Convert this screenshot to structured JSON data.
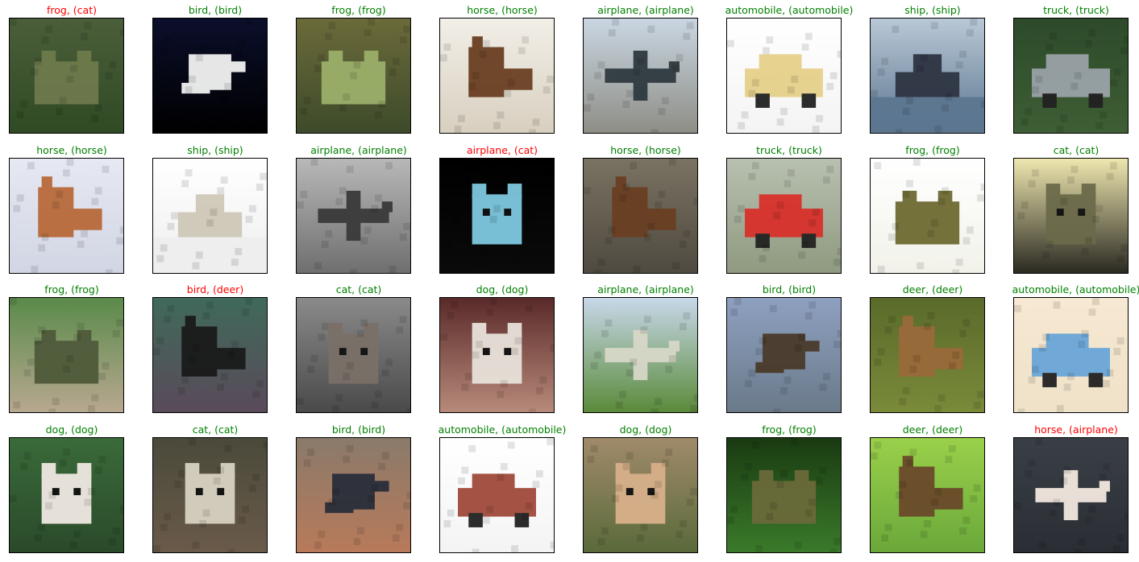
{
  "figure": {
    "panels": [
      {
        "label": "frog, (cat)",
        "correct": false,
        "subject": "frog-photo",
        "bg": [
          "#4b5e3a",
          "#2f4a24"
        ],
        "fg": "#6e7a4c"
      },
      {
        "label": "bird, (bird)",
        "correct": true,
        "subject": "bird-photo",
        "bg": [
          "#0b0f2a",
          "#000000"
        ],
        "fg": "#f2f2f2"
      },
      {
        "label": "frog, (frog)",
        "correct": true,
        "subject": "frog-photo",
        "bg": [
          "#6b6a3a",
          "#3d4a2a"
        ],
        "fg": "#9bb06a"
      },
      {
        "label": "horse, (horse)",
        "correct": true,
        "subject": "horse-photo",
        "bg": [
          "#f2efe8",
          "#d8cfbf"
        ],
        "fg": "#6a3f22"
      },
      {
        "label": "airplane, (airplane)",
        "correct": true,
        "subject": "airplane-photo",
        "bg": [
          "#c9d6e2",
          "#8e8e86"
        ],
        "fg": "#2f3a40"
      },
      {
        "label": "automobile, (automobile)",
        "correct": true,
        "subject": "automobile-photo",
        "bg": [
          "#ffffff",
          "#f4f4f4"
        ],
        "fg": "#e6d08a"
      },
      {
        "label": "ship, (ship)",
        "correct": true,
        "subject": "ship-photo",
        "bg": [
          "#b9c8d6",
          "#5c7690"
        ],
        "fg": "#2e3442"
      },
      {
        "label": "truck, (truck)",
        "correct": true,
        "subject": "truck-photo",
        "bg": [
          "#2d4a2a",
          "#3e5e35"
        ],
        "fg": "#9aa3a8"
      },
      {
        "label": "horse, (horse)",
        "correct": true,
        "subject": "horse-photo",
        "bg": [
          "#e6e8f2",
          "#d2d6e4"
        ],
        "fg": "#b86a3a"
      },
      {
        "label": "ship, (ship)",
        "correct": true,
        "subject": "ship-photo",
        "bg": [
          "#ffffff",
          "#eeeeee"
        ],
        "fg": "#cfc8b8"
      },
      {
        "label": "airplane, (airplane)",
        "correct": true,
        "subject": "airplane-photo",
        "bg": [
          "#b8b8b8",
          "#6f6f6f"
        ],
        "fg": "#3a3a3a"
      },
      {
        "label": "airplane, (cat)",
        "correct": false,
        "subject": "cat-photo",
        "bg": [
          "#000000",
          "#0a0a0a"
        ],
        "fg": "#7fc8e0"
      },
      {
        "label": "horse, (horse)",
        "correct": true,
        "subject": "horse-photo",
        "bg": [
          "#7a7262",
          "#4f4a40"
        ],
        "fg": "#6a3f22"
      },
      {
        "label": "truck, (truck)",
        "correct": true,
        "subject": "truck-photo",
        "bg": [
          "#b8c0b0",
          "#8f9a80"
        ],
        "fg": "#d8302a"
      },
      {
        "label": "frog, (frog)",
        "correct": true,
        "subject": "frog-photo",
        "bg": [
          "#ffffff",
          "#f2f2ea"
        ],
        "fg": "#6e6a32"
      },
      {
        "label": "cat, (cat)",
        "correct": true,
        "subject": "cat-photo",
        "bg": [
          "#efe7b0",
          "#2a2a22"
        ],
        "fg": "#6b6a4a"
      },
      {
        "label": "frog, (frog)",
        "correct": true,
        "subject": "frog-photo",
        "bg": [
          "#5a8a4a",
          "#b8a890"
        ],
        "fg": "#4f5a3a"
      },
      {
        "label": "bird, (deer)",
        "correct": false,
        "subject": "deer-photo",
        "bg": [
          "#3f6a5a",
          "#5a4a5a"
        ],
        "fg": "#1a1a1a"
      },
      {
        "label": "cat, (cat)",
        "correct": true,
        "subject": "cat-photo",
        "bg": [
          "#8a8a8a",
          "#4a4a4a"
        ],
        "fg": "#7a7068"
      },
      {
        "label": "dog, (dog)",
        "correct": true,
        "subject": "dog-photo",
        "bg": [
          "#5a2a2a",
          "#b88a7a"
        ],
        "fg": "#e8e2da"
      },
      {
        "label": "airplane, (airplane)",
        "correct": true,
        "subject": "airplane-photo",
        "bg": [
          "#c8d8ea",
          "#5a8a3a"
        ],
        "fg": "#d8d8c8"
      },
      {
        "label": "bird, (bird)",
        "correct": true,
        "subject": "bird-photo",
        "bg": [
          "#8ea0c0",
          "#6a7a8a"
        ],
        "fg": "#4a3a2a"
      },
      {
        "label": "deer, (deer)",
        "correct": true,
        "subject": "deer-photo",
        "bg": [
          "#5a6a2a",
          "#7a8a3a"
        ],
        "fg": "#9a6a3a"
      },
      {
        "label": "automobile, (automobile)",
        "correct": true,
        "subject": "automobile-photo",
        "bg": [
          "#f6e8d2",
          "#efe2c8"
        ],
        "fg": "#6aa6d8"
      },
      {
        "label": "dog, (dog)",
        "correct": true,
        "subject": "dog-photo",
        "bg": [
          "#3a6a3a",
          "#2a4a2a"
        ],
        "fg": "#efe8e2"
      },
      {
        "label": "cat, (cat)",
        "correct": true,
        "subject": "cat-photo",
        "bg": [
          "#4a4a3a",
          "#6a5a4a"
        ],
        "fg": "#d8d2c2"
      },
      {
        "label": "bird, (bird)",
        "correct": true,
        "subject": "bird-photo",
        "bg": [
          "#8a7a6a",
          "#b87a5a"
        ],
        "fg": "#2a2f3a"
      },
      {
        "label": "automobile, (automobile)",
        "correct": true,
        "subject": "automobile-photo",
        "bg": [
          "#ffffff",
          "#f4f4f4"
        ],
        "fg": "#a04a3a"
      },
      {
        "label": "dog, (dog)",
        "correct": true,
        "subject": "dog-photo",
        "bg": [
          "#a08a6a",
          "#5a6a3a"
        ],
        "fg": "#d8b08a"
      },
      {
        "label": "frog, (frog)",
        "correct": true,
        "subject": "frog-photo",
        "bg": [
          "#1a3a12",
          "#3a7a2a"
        ],
        "fg": "#6a6a3a"
      },
      {
        "label": "deer, (deer)",
        "correct": true,
        "subject": "deer-photo",
        "bg": [
          "#9ad04a",
          "#6aa83a"
        ],
        "fg": "#6a4a2a"
      },
      {
        "label": "horse, (airplane)",
        "correct": false,
        "subject": "airplane-photo",
        "bg": [
          "#3a3f46",
          "#2a2e34"
        ],
        "fg": "#f2e8e0"
      }
    ]
  }
}
